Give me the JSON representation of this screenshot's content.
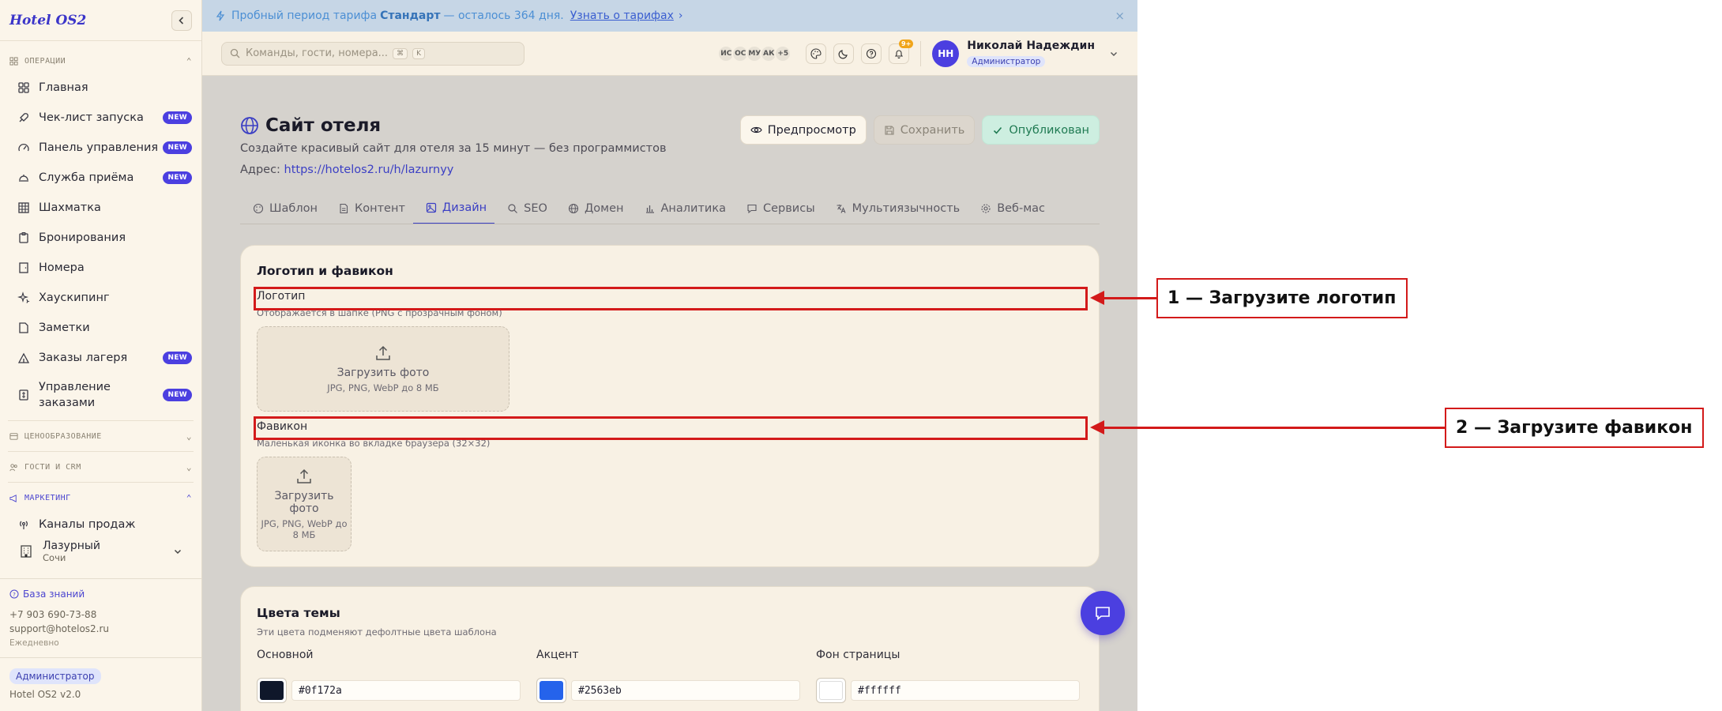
{
  "sidebar": {
    "brand": "Hotel OS2",
    "groups": {
      "operations": "ОПЕРАЦИИ",
      "pricing": "ЦЕНООБРАЗОВАНИЕ",
      "guests": "ГОСТИ И CRM",
      "marketing": "МАРКЕТИНГ"
    },
    "items": [
      {
        "label": "Главная",
        "icon": "grid-icon",
        "badge": ""
      },
      {
        "label": "Чек-лист запуска",
        "icon": "rocket-icon",
        "badge": "NEW"
      },
      {
        "label": "Панель управления",
        "icon": "gauge-icon",
        "badge": "NEW"
      },
      {
        "label": "Служба приёма",
        "icon": "bell-concierge-icon",
        "badge": "NEW"
      },
      {
        "label": "Шахматка",
        "icon": "table-grid-icon",
        "badge": ""
      },
      {
        "label": "Бронирования",
        "icon": "clipboard-icon",
        "badge": ""
      },
      {
        "label": "Номера",
        "icon": "door-icon",
        "badge": ""
      },
      {
        "label": "Хаускипинг",
        "icon": "sparkle-icon",
        "badge": ""
      },
      {
        "label": "Заметки",
        "icon": "note-icon",
        "badge": ""
      },
      {
        "label": "Заказы лагеря",
        "icon": "tent-icon",
        "badge": "NEW"
      },
      {
        "label": "Управление заказами",
        "icon": "receipt-icon",
        "badge": "NEW"
      }
    ],
    "marketing_items": [
      {
        "label": "Каналы продаж",
        "icon": "broadcast-icon"
      }
    ],
    "hotel": {
      "name": "Лазурный",
      "city": "Сочи"
    },
    "support": {
      "knowledge_base": "База знаний",
      "phone": "+7 903 690-73-88",
      "email": "support@hotelos2.ru",
      "hours": "Ежедневно"
    },
    "footer": {
      "role": "Администратор",
      "version": "Hotel OS2 v2.0"
    }
  },
  "banner": {
    "prefix": "Пробный период тарифа",
    "plan": "Стандарт",
    "suffix": "— осталось 364 дня.",
    "link": "Узнать о тарифах",
    "link_arrow": "›",
    "close": "×"
  },
  "topbar": {
    "search_placeholder": "Команды, гости, номера...",
    "kbd": [
      "⌘",
      "K"
    ],
    "presence": [
      "ИС",
      "ОС",
      "МУ",
      "АК",
      "+5"
    ],
    "notif_count": "9+",
    "user": {
      "initials": "НН",
      "name": "Николай Надеждин",
      "role": "Администратор"
    }
  },
  "page": {
    "title": "Сайт отеля",
    "subtitle": "Создайте красивый сайт для отеля за 15 минут — без программистов",
    "address_label": "Адрес:",
    "address_url": "https://hotelos2.ru/h/lazurnyy",
    "actions": {
      "preview": "Предпросмотр",
      "save": "Сохранить",
      "published": "Опубликован"
    },
    "tabs": [
      {
        "label": "Шаблон",
        "icon": "palette-icon"
      },
      {
        "label": "Контент",
        "icon": "file-icon"
      },
      {
        "label": "Дизайн",
        "icon": "image-icon"
      },
      {
        "label": "SEO",
        "icon": "search-icon"
      },
      {
        "label": "Домен",
        "icon": "globe-icon"
      },
      {
        "label": "Аналитика",
        "icon": "bar-chart-icon"
      },
      {
        "label": "Сервисы",
        "icon": "message-icon"
      },
      {
        "label": "Мультиязычность",
        "icon": "translate-icon"
      },
      {
        "label": "Веб-мас",
        "icon": "gear-icon"
      }
    ],
    "active_tab": "Дизайн"
  },
  "logo_card": {
    "title": "Логотип и фавикон",
    "logo": {
      "label": "Логотип",
      "help": "Отображается в шапке (PNG с прозрачным фоном)",
      "upload_text": "Загрузить фото",
      "upload_hint": "JPG, PNG, WebP до 8 МБ"
    },
    "favicon": {
      "label": "Фавикон",
      "help": "Маленькая иконка во вкладке браузера (32×32)",
      "upload_text": "Загрузить фото",
      "upload_hint": "JPG, PNG, WebP до 8 МБ"
    }
  },
  "colors_card": {
    "title": "Цвета темы",
    "help": "Эти цвета подменяют дефолтные цвета шаблона",
    "fields": [
      {
        "label": "Основной",
        "value": "#0f172a"
      },
      {
        "label": "Акцент",
        "value": "#2563eb"
      },
      {
        "label": "Фон страницы",
        "value": "#ffffff"
      }
    ]
  },
  "annotations": [
    {
      "label": "1 — Загрузите логотип"
    },
    {
      "label": "2 — Загрузите фавикон"
    }
  ],
  "colors": {
    "accent": "#3b3fc4",
    "brand": "#4b3fe0",
    "annotation": "#d31a1a"
  }
}
